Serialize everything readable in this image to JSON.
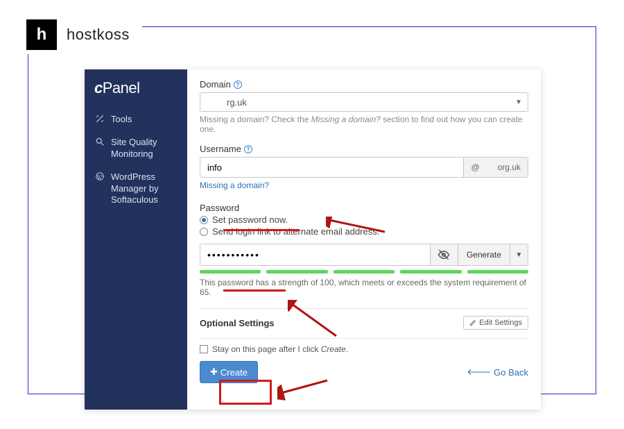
{
  "brand": {
    "logo_letter": "h",
    "name": "hostkoss"
  },
  "sidebar": {
    "logo_prefix": "c",
    "logo_text": "Panel",
    "items": [
      {
        "label": "Tools"
      },
      {
        "label": "Site Quality Monitoring"
      },
      {
        "label": "WordPress Manager by Softaculous"
      }
    ]
  },
  "form": {
    "domain_label": "Domain",
    "domain_value": "rg.uk",
    "domain_hint_pre": "Missing a domain? Check the ",
    "domain_hint_em": "Missing a domain?",
    "domain_hint_post": " section to find out how you can create one.",
    "username_label": "Username",
    "username_value": "info",
    "username_at": "@",
    "username_suffix": "org.uk",
    "missing_link": "Missing a domain?",
    "password_label": "Password",
    "pw_opt1": "Set password now.",
    "pw_opt2": "Send login link to alternate email address.",
    "pw_value": "•••••••••••",
    "generate_label": "Generate",
    "strength_text": "This password has a strength of 100, which meets or exceeds the system requirement of 65.",
    "optional_title": "Optional Settings",
    "edit_settings": "Edit Settings",
    "stay_text_pre": "Stay on this page after I click ",
    "stay_text_em": "Create",
    "stay_text_post": ".",
    "create_label": "Create",
    "go_back": "Go Back"
  }
}
